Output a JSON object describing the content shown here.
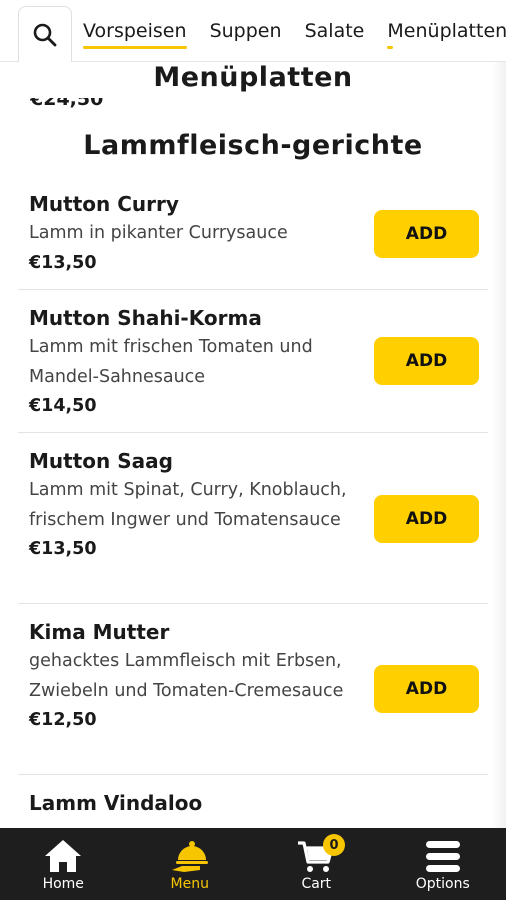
{
  "categories": {
    "tabs": [
      {
        "label": "Vorspeisen",
        "active": true
      },
      {
        "label": "Suppen",
        "active": false
      },
      {
        "label": "Salate",
        "active": false
      },
      {
        "label": "Menüplatten",
        "active": false
      }
    ]
  },
  "sticky_header": {
    "title": "Menüplatten",
    "partial_price": "€24,50"
  },
  "section": {
    "title": "Lammfleisch-gerichte"
  },
  "items": [
    {
      "name": "Mutton Curry",
      "description": "Lamm in pikanter Currysauce",
      "price": "€13,50",
      "add_label": "ADD"
    },
    {
      "name": "Mutton Shahi-Korma",
      "description": "Lamm mit frischen Tomaten und Mandel-Sahnesauce",
      "price": "€14,50",
      "add_label": "ADD"
    },
    {
      "name": "Mutton Saag",
      "description": "Lamm mit Spinat, Curry, Knoblauch, frischem Ingwer und Tomatensauce",
      "price": "€13,50",
      "add_label": "ADD"
    },
    {
      "name": "Kima Mutter",
      "description": "gehacktes Lammfleisch mit Erbsen, Zwiebeln und Tomaten-Cremesauce",
      "price": "€12,50",
      "add_label": "ADD"
    },
    {
      "name": "Lamm Vindaloo",
      "description": "",
      "price": "",
      "add_label": ""
    }
  ],
  "bottom_nav": {
    "home": "Home",
    "menu": "Menu",
    "cart": "Cart",
    "cart_count": "0",
    "options": "Options"
  },
  "colors": {
    "accent": "#ffcf00",
    "nav_bg": "#1e1e1e"
  },
  "icons": [
    "search-icon",
    "home-icon",
    "menu-cloche-icon",
    "cart-icon",
    "options-bars-icon"
  ]
}
